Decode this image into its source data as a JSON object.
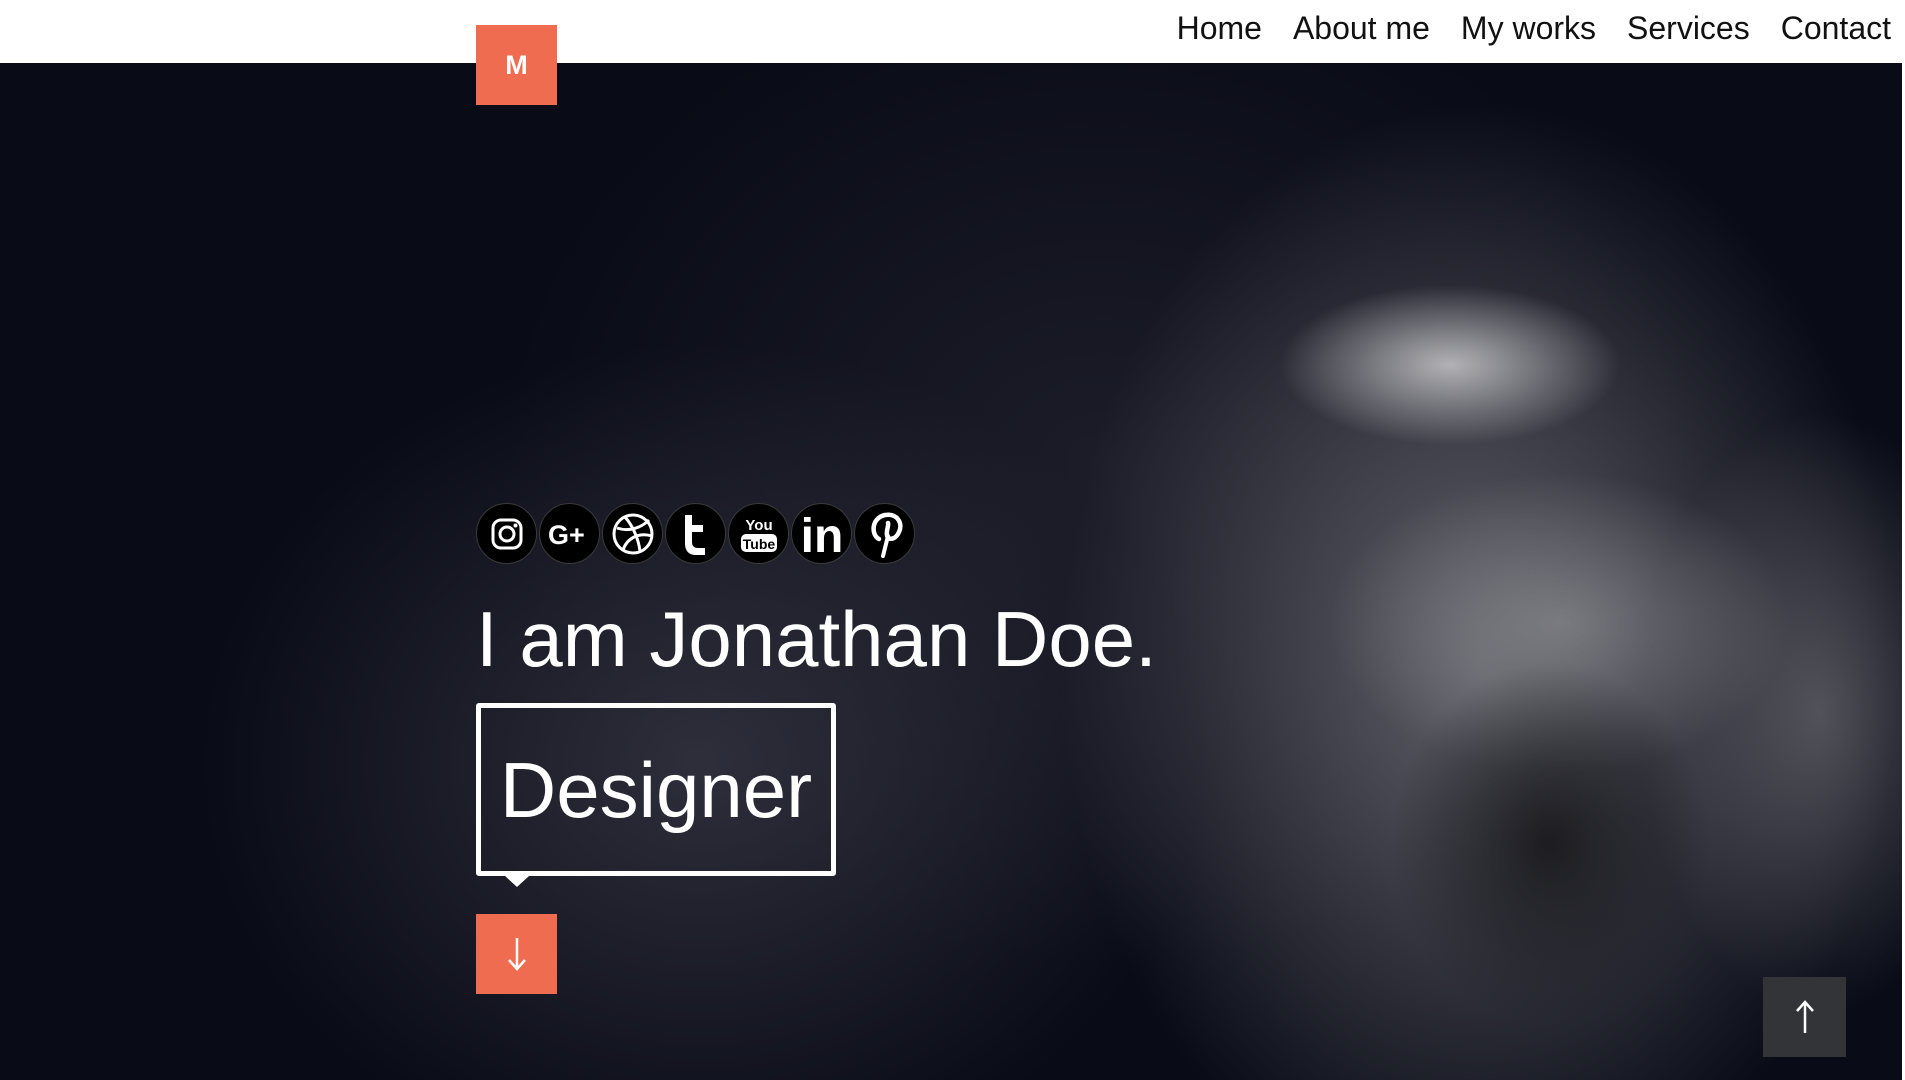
{
  "logo": {
    "letter": "M",
    "color": "#ef6c50"
  },
  "nav": {
    "items": [
      {
        "label": "Home"
      },
      {
        "label": "About me"
      },
      {
        "label": "My works"
      },
      {
        "label": "Services"
      },
      {
        "label": "Contact"
      }
    ]
  },
  "socials": [
    {
      "icon": "instagram-icon"
    },
    {
      "icon": "google-plus-icon",
      "text": "G+"
    },
    {
      "icon": "dribbble-icon"
    },
    {
      "icon": "tumblr-icon"
    },
    {
      "icon": "youtube-icon",
      "text_top": "You",
      "text_bottom": "Tube"
    },
    {
      "icon": "linkedin-icon",
      "text": "in"
    },
    {
      "icon": "pinterest-icon"
    }
  ],
  "hero": {
    "headline": "I am Jonathan Doe.",
    "role": "Designer",
    "scroll_down_icon": "arrow-down-icon"
  },
  "back_to_top": {
    "icon": "arrow-up-icon"
  },
  "colors": {
    "accent": "#ef6c50",
    "hero_bg": "#090b16",
    "back_to_top_bg": "#333437"
  }
}
